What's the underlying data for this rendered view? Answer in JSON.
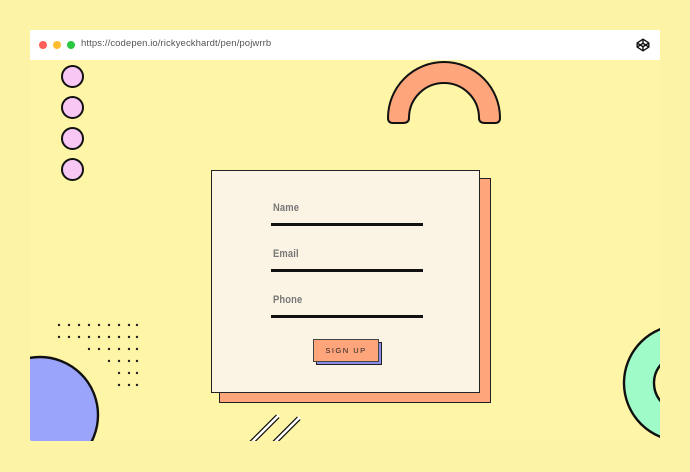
{
  "browser": {
    "url": "https://codepen.io/rickyeckhardt/pen/pojwrrb",
    "brand_icon": "codepen-icon"
  },
  "form": {
    "fields": [
      {
        "label": "Name"
      },
      {
        "label": "Email"
      },
      {
        "label": "Phone"
      }
    ],
    "submit_label": "SIGN UP"
  },
  "colors": {
    "background": "#fef5a6",
    "card": "#fbf4e5",
    "accent_orange": "#ffa57c",
    "accent_blue": "#8a8ce8",
    "accent_pink": "#f8c7f4",
    "accent_green": "#9ffcc8"
  }
}
